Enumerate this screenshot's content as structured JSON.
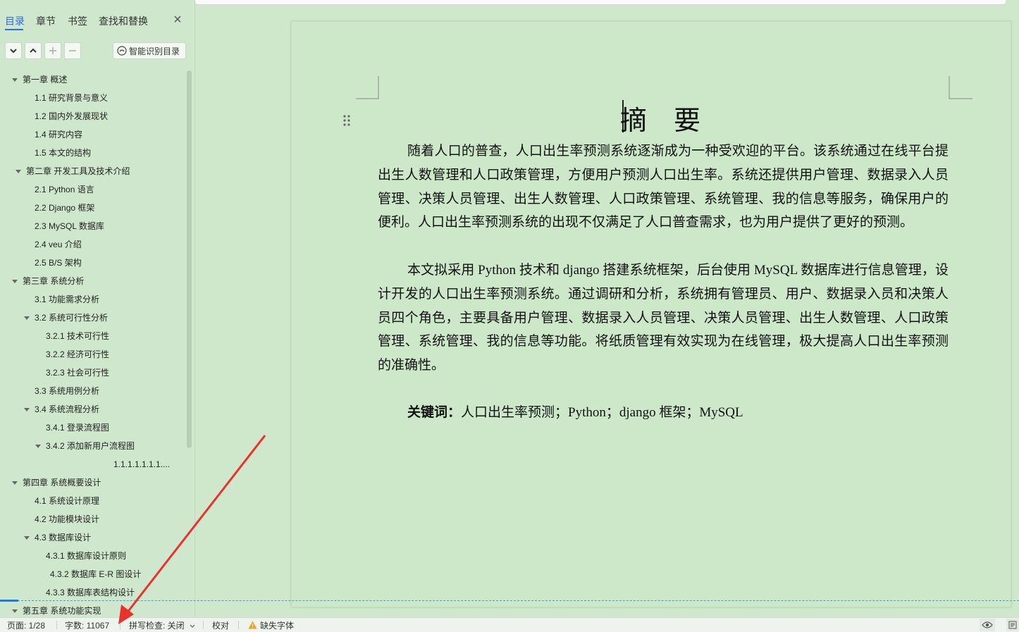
{
  "nav": {
    "tabs": [
      "目录",
      "章节",
      "书签",
      "查找和替换"
    ],
    "close_symbol": "×",
    "toolbar": {
      "expand_icon": "chevron-down-icon",
      "collapse_icon": "chevron-up-icon",
      "add_icon": "plus-icon",
      "remove_icon": "minus-icon",
      "smart_label": "智能识别目录"
    },
    "toc": [
      {
        "label": "第一章  概述",
        "level": 0,
        "expanded": true
      },
      {
        "label": "1.1  研究背景与意义",
        "level": 1
      },
      {
        "label": "1.2 国内外发展现状",
        "level": 1
      },
      {
        "label": "1.4  研究内容",
        "level": 1
      },
      {
        "label": "1.5 本文的结构",
        "level": 1
      },
      {
        "label": "第二章  开发工具及技术介绍",
        "level": 0,
        "expanded": true
      },
      {
        "label": "2.1 Python 语言",
        "level": 1
      },
      {
        "label": "2.2 Django 框架",
        "level": 1
      },
      {
        "label": "2.3 MySQL 数据库",
        "level": 1
      },
      {
        "label": "2.4 veu 介绍",
        "level": 1
      },
      {
        "label": "2.5 B/S 架构",
        "level": 1
      },
      {
        "label": "第三章  系统分析",
        "level": 0,
        "expanded": true
      },
      {
        "label": "3.1 功能需求分析",
        "level": 1
      },
      {
        "label": "3.2 系统可行性分析",
        "level": 1,
        "expanded": true
      },
      {
        "label": "3.2.1 技术可行性",
        "level": 2
      },
      {
        "label": "3.2.2  经济可行性",
        "level": 2
      },
      {
        "label": "3.2.3 社会可行性",
        "level": 2
      },
      {
        "label": "3.3  系统用例分析",
        "level": 1
      },
      {
        "label": "3.4 系统流程分析",
        "level": 1,
        "expanded": true
      },
      {
        "label": "3.4.1  登录流程图",
        "level": 2
      },
      {
        "label": "3.4.2  添加新用户流程图",
        "level": 2,
        "expanded": true
      },
      {
        "label": "1.1.1.1.1.1.1....",
        "level": 3
      },
      {
        "label": "第四章  系统概要设计",
        "level": 0,
        "expanded": true
      },
      {
        "label": "4.1 系统设计原理",
        "level": 1
      },
      {
        "label": "4.2 功能模块设计",
        "level": 1
      },
      {
        "label": "4.3  数据库设计",
        "level": 1,
        "expanded": true
      },
      {
        "label": "4.3.1 数据库设计原则",
        "level": 2
      },
      {
        "label": "4.3.2 数据库 E-R 图设计",
        "level": 2
      },
      {
        "label": "4.3.3 数据库表结构设计",
        "level": 2
      },
      {
        "label": "第五章  系统功能实现",
        "level": 0,
        "expanded": true
      }
    ]
  },
  "document": {
    "title": "摘    要",
    "paragraph1": "随着人口的普查，人口出生率预测系统逐渐成为一种受欢迎的平台。该系统通过在线平台提出生人数管理和人口政策管理，方便用户预测人口出生率。系统还提供用户管理、数据录入人员管理、决策人员管理、出生人数管理、人口政策管理、系统管理、我的信息等服务，确保用户的便利。人口出生率预测系统的出现不仅满足了人口普查需求，也为用户提供了更好的预测。",
    "paragraph2": "本文拟采用 Python 技术和 django 搭建系统框架，后台使用 MySQL 数据库进行信息管理，设计开发的人口出生率预测系统。通过调研和分析，系统拥有管理员、用户、数据录入员和决策人员四个角色，主要具备用户管理、数据录入人员管理、决策人员管理、出生人数管理、人口政策管理、系统管理、我的信息等功能。将纸质管理有效实现为在线管理，极大提高人口出生率预测的准确性。",
    "keywords_label": "关键词：",
    "keywords_text": "人口出生率预测；Python；django 框架；MySQL"
  },
  "status_bar": {
    "page": "页面: 1/28",
    "word_count": "字数: 11067",
    "spell_check": "拼写检查: 关闭",
    "proofread": "校对",
    "missing_font": "缺失字体"
  },
  "colors": {
    "accent": "#2a6be0",
    "page_bg": "#cce8c9",
    "annotation_arrow": "#e8322b",
    "warning": "#f0a020"
  }
}
